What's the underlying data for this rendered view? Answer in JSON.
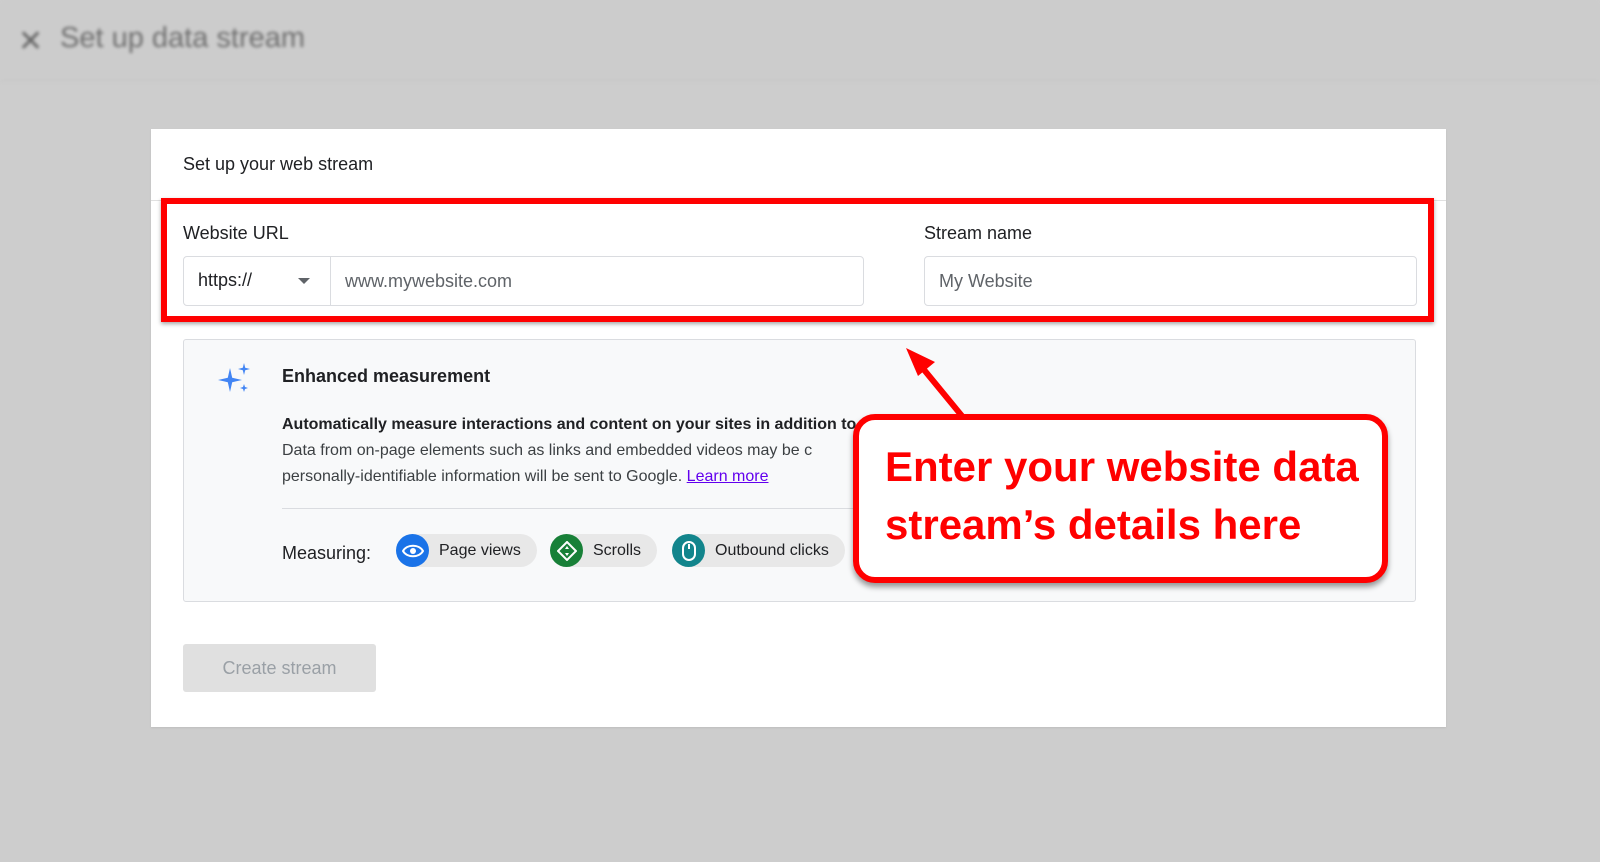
{
  "header": {
    "close_icon": "close-icon",
    "title": "Set up data stream"
  },
  "card": {
    "title": "Set up your web stream",
    "website_url": {
      "label": "Website URL",
      "protocol": "https://",
      "placeholder": "www.mywebsite.com",
      "value": ""
    },
    "stream_name": {
      "label": "Stream name",
      "placeholder": "My Website",
      "value": ""
    },
    "enhanced": {
      "icon": "sparkle-icon",
      "title": "Enhanced measurement",
      "desc_lead": "Automatically measure interactions and content on your sites in addition to",
      "desc_line2": "Data from on-page elements such as links and embedded videos may be c",
      "desc_line3": "personally-identifiable information will be sent to Google.",
      "learn_more": "Learn more",
      "measuring_label": "Measuring:",
      "chips": [
        {
          "label": "Page views",
          "icon": "eye-icon",
          "color": "#1a73e8"
        },
        {
          "label": "Scrolls",
          "icon": "scroll-icon",
          "color": "#188038"
        },
        {
          "label": "Outbound clicks",
          "icon": "mouse-icon",
          "color": "#12858c"
        }
      ]
    },
    "create_button": "Create stream"
  },
  "annotation": {
    "line1": "Enter your website data",
    "line2": "stream’s details here",
    "color": "#ff0000"
  }
}
